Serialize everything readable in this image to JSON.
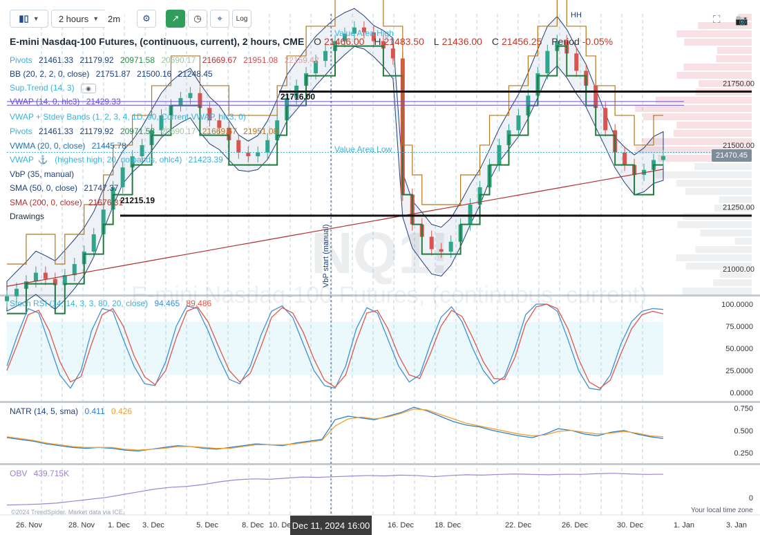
{
  "toolbar": {
    "chart_style_icon": "candles-icon",
    "interval": "2 hours",
    "interval_short": "2m",
    "settings_icon": "gear-icon",
    "drawing_icon": "line-tool-icon",
    "clock_icon": "clock-icon",
    "crosshair_icon": "crosshair-icon",
    "log_label": "Log",
    "fullscreen_icon": "expand-icon",
    "camera_icon": "camera-icon"
  },
  "header": {
    "title": "E-mini Nasdaq-100 Futures, (continuous, current), 2 hours, CME",
    "o_label": "O",
    "o_value": "21466.00",
    "h_label": "H",
    "h_value": "21483.50",
    "l_label": "L",
    "l_value": "21436.00",
    "c_label": "C",
    "c_value": "21456.25",
    "period_label": "Period",
    "period_value": "-0.05%"
  },
  "legend": {
    "pivots": {
      "name": "Pivots",
      "values": [
        "21461.33",
        "21179.92",
        "20971.58",
        "20690.17",
        "21669.67",
        "21951.08",
        "22159.42"
      ]
    },
    "bb": {
      "name": "BB (20, 2, 2, 0, close)",
      "values": [
        "21751.87",
        "21500.16",
        "21248.45"
      ]
    },
    "suptrend": {
      "name": "Sup.Trend (14, 3)"
    },
    "vwap1": {
      "name": "VWAP (14, 0, hlc3)",
      "values": [
        "21429.33"
      ]
    },
    "vwap_bands": {
      "name": "VWAP + Stdev Bands (1, 2, 3, 4, 1D, 90, Current VWAP, hlc3, 0)"
    },
    "pivots2": {
      "name": "Pivots",
      "values": [
        "21461.33",
        "21179.92",
        "20971.58",
        "20690.17",
        "21669.67",
        "21951.08"
      ]
    },
    "vwma": {
      "name": "VWMA (20, 0, close)",
      "values": [
        "21445.78"
      ]
    },
    "vwap_anchor": {
      "name": "VWAP",
      "rest": "(highest high, 20, no bands, ohlc4)",
      "values": [
        "21423.39"
      ]
    },
    "vbp": {
      "name": "VbP (35, manual)"
    },
    "sma50": {
      "name": "SMA (50, 0, close)",
      "values": [
        "21747.37"
      ]
    },
    "sma200": {
      "name": "SMA (200, 0, close)",
      "values": [
        "21676.31"
      ]
    },
    "drawings": {
      "name": "Drawings"
    }
  },
  "annotations": {
    "value_area_high": "Value Area High",
    "value_area_low": "Value Area Low",
    "hline_upper": "21716.00",
    "hline_lower": "21215.19",
    "vbp_start": "VbP start (manual)",
    "hh": "HH",
    "watermark": "NQ1!",
    "watermark2": "E-mini Nasdaq-100 Futures, (continuous, current)",
    "footer_left": "©2024 TrendSpider. Market data via ICE.",
    "footer_right": "Your local time zone"
  },
  "price_badge": "21470.45",
  "time_badge": "Dec 11, 2024 16:00",
  "colors": {
    "bull": "#2fa58c",
    "bear": "#d9534f",
    "bb": "#1d3f7a",
    "pivot": "#b5761d",
    "pivot_green": "#1f7a3c",
    "sma200": "#b03030",
    "vwap": "#6b4fcf",
    "stoch_k": "#3f8fd6",
    "stoch_d": "#e0554a",
    "natr1": "#2d7fd0",
    "natr2": "#f0a030",
    "obv": "#9b84d6",
    "accent_cyan": "#3bb2d8"
  },
  "chart_data": [
    {
      "type": "candlestick",
      "title": "E-mini Nasdaq-100 Futures, (continuous, current), 2 hours, CME",
      "x_ticks": [
        "26. Nov",
        "28. Nov",
        "1. Dec",
        "3. Dec",
        "5. Dec",
        "8. Dec",
        "10. Dec",
        "16. Dec",
        "18. Dec",
        "22. Dec",
        "26. Dec",
        "30. Dec",
        "1. Jan",
        "3. Jan"
      ],
      "y_ticks": [
        "21000.00",
        "21250.00",
        "21500.00",
        "21750.00"
      ],
      "ylim": [
        20900,
        22030
      ],
      "close_series": [
        20890,
        20920,
        20950,
        20985,
        20960,
        20935,
        20975,
        21020,
        21070,
        21140,
        21240,
        21330,
        21410,
        21455,
        21500,
        21560,
        21620,
        21660,
        21690,
        21710,
        21650,
        21600,
        21570,
        21520,
        21470,
        21455,
        21470,
        21520,
        21600,
        21690,
        21740,
        21790,
        21840,
        21880,
        21920,
        21950,
        21975,
        21955,
        21920,
        21890,
        21850,
        21300,
        21180,
        21130,
        21080,
        21070,
        21110,
        21180,
        21260,
        21330,
        21420,
        21500,
        21560,
        21620,
        21700,
        21790,
        21880,
        21920,
        21870,
        21800,
        21740,
        21650,
        21560,
        21470,
        21420,
        21380,
        21400,
        21440,
        21456
      ],
      "horizontal_lines": [
        21716.0,
        21215.19
      ],
      "last_price": 21470.45
    },
    {
      "type": "line",
      "title": "Stoch RSI (14, 14, 3, 3, 80, 20, close)",
      "values_shown": [
        94.465,
        89.486
      ],
      "y_ticks": [
        "0.0000",
        "25.0000",
        "50.0000",
        "75.0000",
        "100.0000"
      ],
      "ylim": [
        0,
        100
      ],
      "band": [
        20,
        80
      ],
      "series": [
        {
          "values": [
            30,
            65,
            95,
            90,
            55,
            20,
            5,
            25,
            70,
            95,
            92,
            60,
            30,
            10,
            8,
            35,
            75,
            98,
            95,
            70,
            40,
            15,
            10,
            30,
            65,
            92,
            98,
            85,
            55,
            25,
            8,
            5,
            30,
            72,
            96,
            90,
            60,
            30,
            12,
            20,
            55,
            85,
            97,
            80,
            50,
            25,
            10,
            18,
            50,
            88,
            100,
            100,
            92,
            60,
            25,
            5,
            3,
            20,
            55,
            80,
            92,
            95,
            94
          ]
        },
        {
          "values": [
            25,
            55,
            88,
            93,
            70,
            35,
            12,
            18,
            55,
            88,
            95,
            75,
            42,
            18,
            9,
            25,
            62,
            92,
            97,
            80,
            52,
            25,
            12,
            22,
            52,
            85,
            96,
            90,
            68,
            38,
            14,
            6,
            20,
            58,
            90,
            93,
            72,
            42,
            20,
            16,
            44,
            75,
            93,
            86,
            62,
            35,
            16,
            15,
            40,
            78,
            97,
            100,
            95,
            72,
            38,
            12,
            5,
            14,
            44,
            72,
            88,
            92,
            89
          ]
        }
      ]
    },
    {
      "type": "line",
      "title": "NATR (14, 5, sma)",
      "values_shown": [
        0.411,
        0.426
      ],
      "y_ticks": [
        "0.250",
        "0.500",
        "0.750"
      ],
      "ylim": [
        0.15,
        0.8
      ],
      "series": [
        {
          "values": [
            0.42,
            0.4,
            0.38,
            0.35,
            0.33,
            0.31,
            0.3,
            0.31,
            0.3,
            0.28,
            0.27,
            0.29,
            0.31,
            0.33,
            0.32,
            0.3,
            0.29,
            0.31,
            0.33,
            0.35,
            0.34,
            0.33,
            0.36,
            0.38,
            0.4,
            0.62,
            0.66,
            0.64,
            0.62,
            0.66,
            0.7,
            0.76,
            0.72,
            0.66,
            0.6,
            0.56,
            0.54,
            0.5,
            0.47,
            0.44,
            0.42,
            0.46,
            0.52,
            0.5,
            0.46,
            0.44,
            0.48,
            0.5,
            0.46,
            0.43,
            0.41
          ]
        },
        {
          "values": [
            0.43,
            0.41,
            0.39,
            0.36,
            0.34,
            0.32,
            0.31,
            0.31,
            0.31,
            0.29,
            0.28,
            0.29,
            0.3,
            0.32,
            0.32,
            0.31,
            0.3,
            0.3,
            0.32,
            0.34,
            0.34,
            0.34,
            0.35,
            0.37,
            0.39,
            0.55,
            0.63,
            0.65,
            0.63,
            0.65,
            0.69,
            0.74,
            0.73,
            0.68,
            0.63,
            0.58,
            0.55,
            0.52,
            0.49,
            0.46,
            0.44,
            0.45,
            0.49,
            0.5,
            0.48,
            0.46,
            0.47,
            0.49,
            0.47,
            0.44,
            0.43
          ]
        }
      ]
    },
    {
      "type": "line",
      "title": "OBV",
      "values_shown": [
        "439.715K"
      ],
      "y_ticks": [
        "0"
      ],
      "series": [
        {
          "values": [
            -40,
            -38,
            -35,
            -30,
            -20,
            -10,
            0,
            15,
            30,
            45,
            55,
            60,
            70,
            85,
            95,
            100,
            98,
            104,
            110,
            108,
            112,
            115,
            118,
            116,
            120,
            118,
            112,
            118,
            122,
            120,
            124,
            126,
            124,
            122,
            125,
            124,
            128,
            130,
            126,
            124,
            125
          ]
        }
      ]
    }
  ]
}
